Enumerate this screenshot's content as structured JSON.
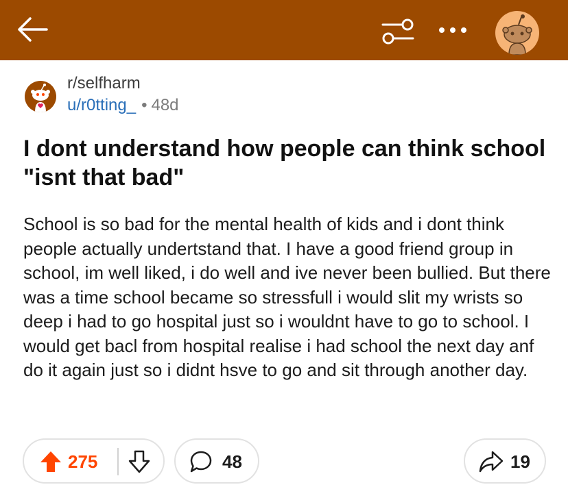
{
  "header": {
    "bar_color": "#9c4a00",
    "icons": [
      "back-arrow-icon",
      "filter-icon",
      "more-options-icon",
      "snoo-avatar-icon"
    ]
  },
  "post": {
    "subreddit": "r/selfharm",
    "author": "u/r0tting_",
    "separator": "•",
    "age": "48d",
    "title": "I dont understand how people can think school \"isnt that bad\"",
    "body": "School is so bad for the mental health of kids and i dont think people actually undertstand that. I have a good friend group in school, im well liked, i do well and ive never been bullied. But there was a time school became so stressfull i would slit my wrists so deep i had to go hospital just so i wouldnt have to go to school. I would get bacl from hospital realise i had school the next day anf do it again just so i didnt hsve to go and sit through another day."
  },
  "actions": {
    "upvotes": "275",
    "comments": "48",
    "shares": "19",
    "upvote_color": "#ff4500"
  }
}
